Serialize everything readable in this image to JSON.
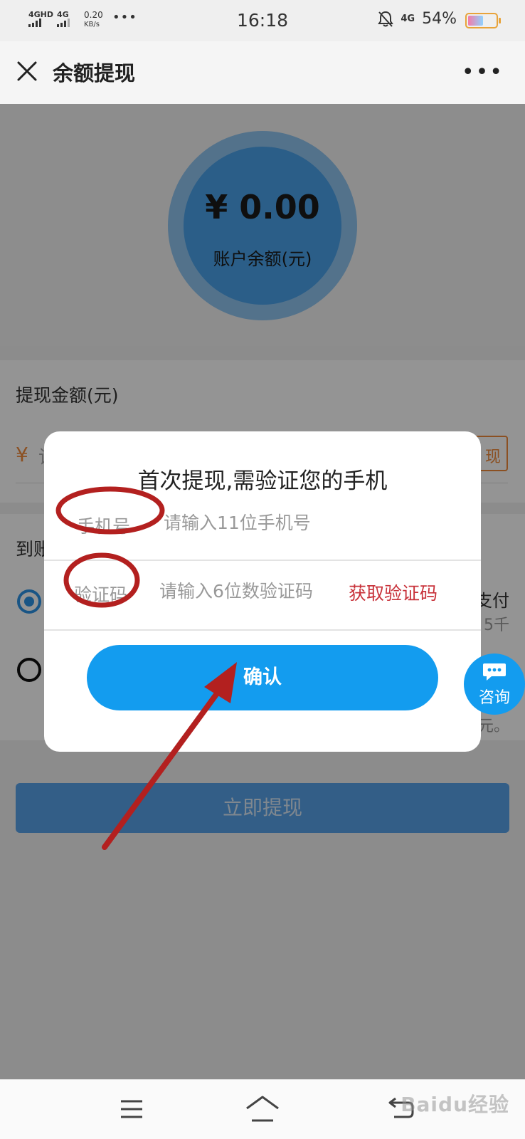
{
  "status_bar": {
    "network_1": "4GHD",
    "network_2": "4G",
    "speed_value": "0.20",
    "speed_unit": "KB/s",
    "more_dots": "•••",
    "time": "16:18",
    "network_3": "4G",
    "battery_text": "54%",
    "battery_level": 0.54
  },
  "nav": {
    "title": "余额提现",
    "more": "•••"
  },
  "balance": {
    "amount": "¥ 0.00",
    "label": "账户余额(元)"
  },
  "amount_section": {
    "label": "提现金额(元)",
    "currency": "¥",
    "input_fragment": "请",
    "all_button_fragment": "现"
  },
  "account_section": {
    "label_fragment": "到账",
    "option_1_fragment": "支付",
    "option_2_fragment": "5千",
    "option_3_fragment": "元。"
  },
  "withdraw_button": "立即提现",
  "dialog": {
    "title": "首次提现,需验证您的手机",
    "phone_label": "手机号",
    "phone_placeholder": "请输入11位手机号",
    "code_label": "验证码",
    "code_placeholder": "请输入6位数验证码",
    "get_code": "获取验证码",
    "confirm": "确认"
  },
  "consult": {
    "label": "咨询"
  },
  "watermark": "Baidu经验",
  "colors": {
    "primary_blue": "#139cef",
    "annotation_red": "#b3201f",
    "get_code_red": "#c8323a",
    "accent_orange": "#f08a3c"
  }
}
